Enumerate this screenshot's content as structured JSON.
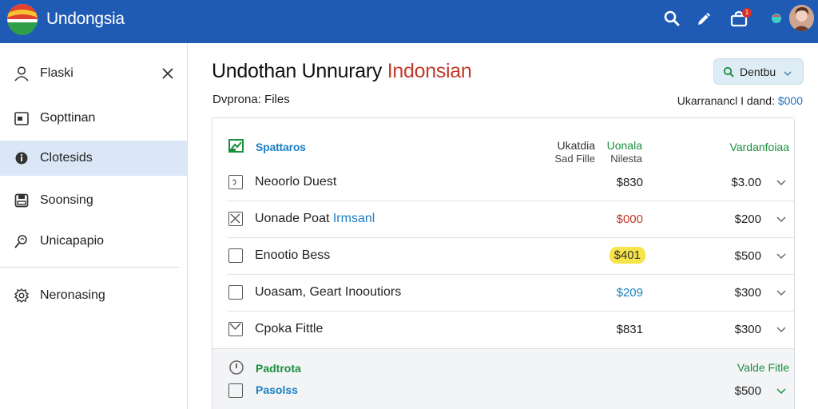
{
  "app": {
    "name": "Undongsia"
  },
  "sidebar": {
    "items": [
      {
        "label": "Flaski",
        "icon": "user-icon",
        "active": false
      },
      {
        "label": "Gopttinan",
        "icon": "calendar-icon",
        "active": false
      },
      {
        "label": "Clotesids",
        "icon": "shield-icon",
        "active": true
      },
      {
        "label": "Soonsing",
        "icon": "save-icon",
        "active": false
      },
      {
        "label": "Unicapapio",
        "icon": "search-person-icon",
        "active": false
      },
      {
        "label": "Neronasing",
        "icon": "gear-icon",
        "active": false
      }
    ]
  },
  "main": {
    "title_main": "Undothan Unnurary ",
    "title_accent": "Indonsian",
    "subtitle": "Dvprona: Files",
    "action_button_label": "Dentbu",
    "total_label": "Ukarranancl I dand:",
    "total_amount": "$000"
  },
  "table": {
    "header_name": "Spattaros",
    "header_col1_line1": "Ukatdia",
    "header_col1_line2": "Sad Fille",
    "header_col2_line1": "Uonala",
    "header_col2_line2": "Nilesta",
    "header_col3": "Vardanfoiaa",
    "rows": [
      {
        "name": "Neoorlo Duest",
        "tag": "",
        "value": "$830",
        "value_style": "plain",
        "amount": "$3.00",
        "checked": false
      },
      {
        "name": "Uonade Poat ",
        "tag": "Irmsanl",
        "value": "$000",
        "value_style": "red",
        "amount": "$200",
        "checked": true
      },
      {
        "name": "Enootio Bess",
        "tag": "",
        "value": "$401",
        "value_style": "highlight",
        "amount": "$500",
        "checked": false
      },
      {
        "name": "Uoasam, Geart Inooutiors",
        "tag": "",
        "value": "$209",
        "value_style": "blue",
        "amount": "$300",
        "checked": false
      },
      {
        "name": "Cpoka Fittle",
        "tag": "",
        "value": "$831",
        "value_style": "plain",
        "amount": "$300",
        "checked": true
      }
    ],
    "section_title": "Padtrota",
    "section_right": "Valde Fitle",
    "section_row_name": "Pasolss",
    "section_row_amount": "$500"
  },
  "colors": {
    "topbar": "#1f5bb5",
    "accent_red": "#c0392b",
    "accent_blue": "#1b7fc4",
    "accent_green": "#1a8f3d",
    "highlight": "#f7e34a"
  }
}
